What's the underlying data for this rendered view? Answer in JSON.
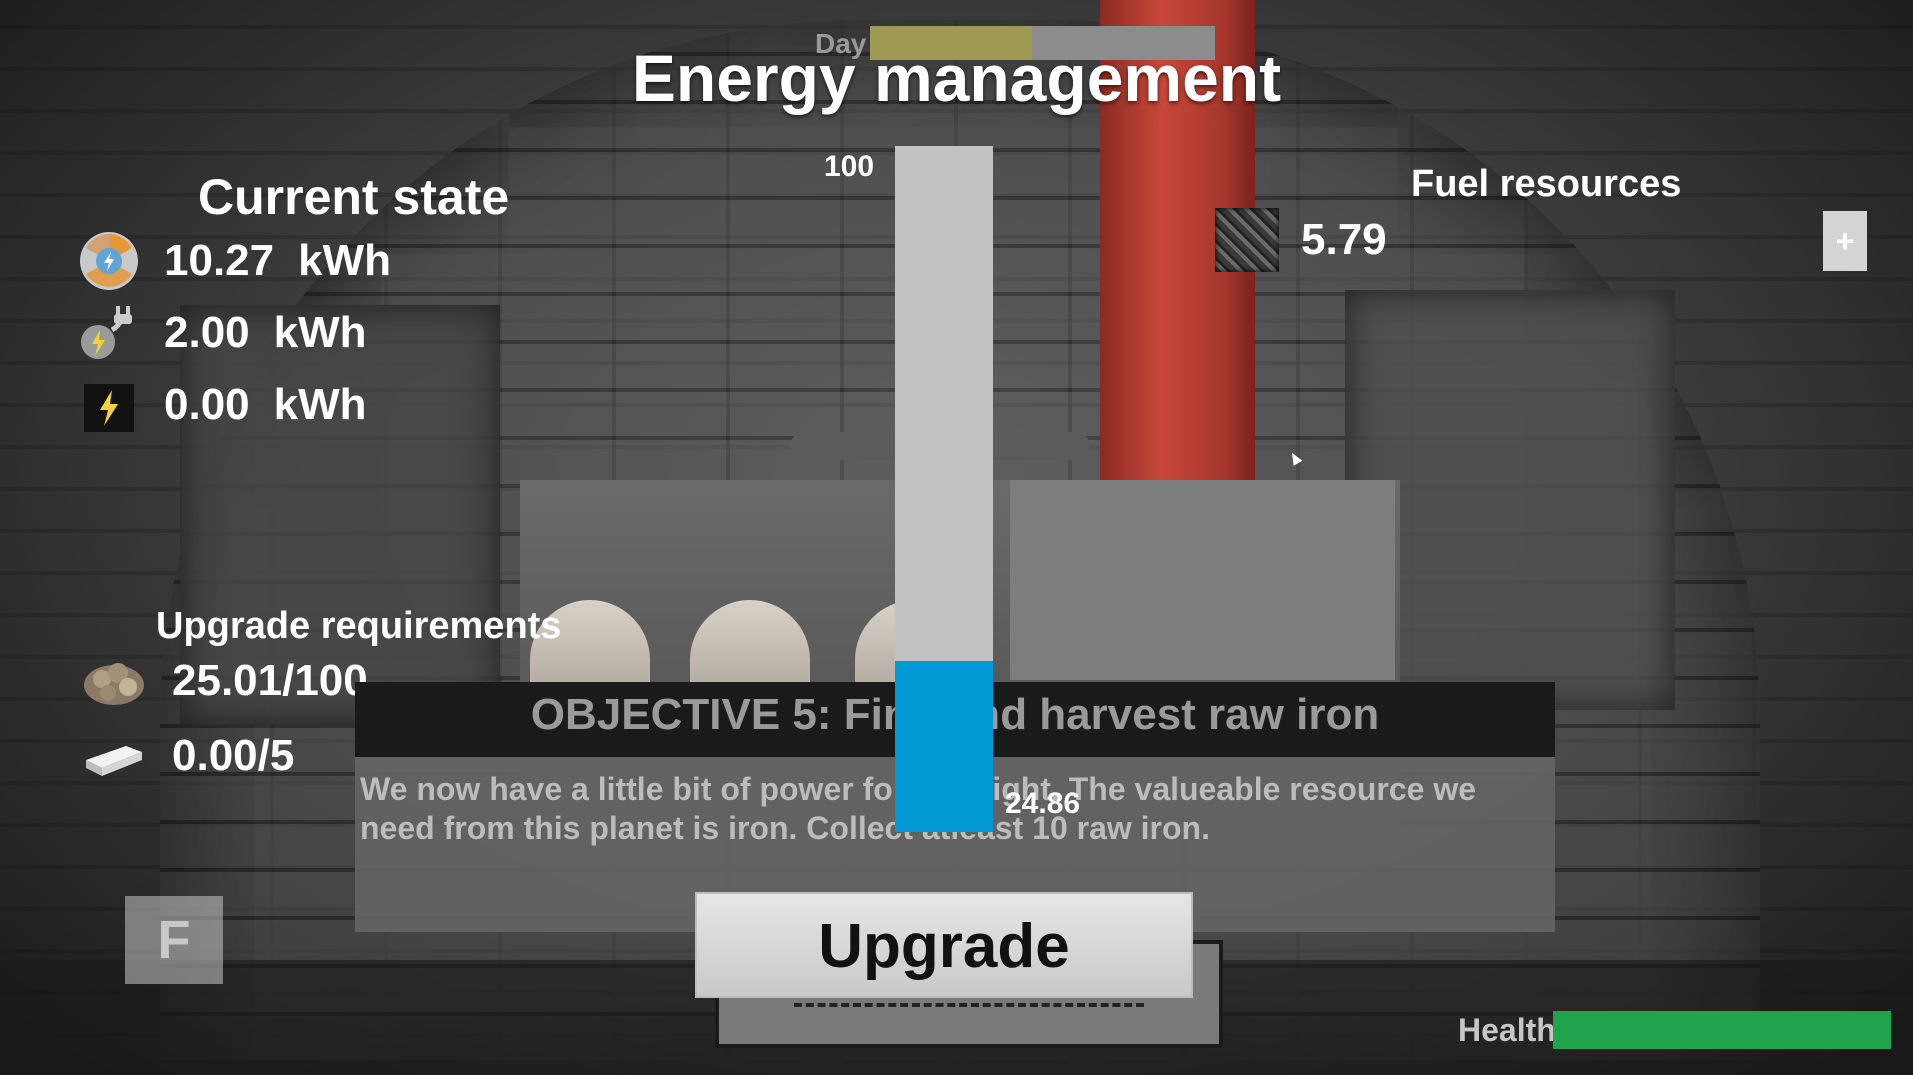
{
  "hud": {
    "day_label": "Day",
    "day_progress": 0.47,
    "title": "Energy management"
  },
  "current_state": {
    "heading": "Current state",
    "rows": [
      {
        "icon": "energy-core-icon",
        "value": "10.27",
        "unit": "kWh"
      },
      {
        "icon": "power-plug-icon",
        "value": "2.00",
        "unit": "kWh"
      },
      {
        "icon": "battery-icon",
        "value": "0.00",
        "unit": "kWh"
      }
    ]
  },
  "upgrade_requirements": {
    "heading": "Upgrade requirements",
    "rows": [
      {
        "icon": "raw-ore-icon",
        "value": "25.01/100"
      },
      {
        "icon": "iron-ingot-icon",
        "value": "0.00/5"
      }
    ]
  },
  "fuel": {
    "heading": "Fuel resources",
    "icon": "coal-icon",
    "value": "5.79",
    "add_label": "+"
  },
  "gauge": {
    "max_label": "100",
    "value_label": "24.86",
    "level": 0.2486,
    "fill_color": "#0298d6"
  },
  "objective": {
    "title": "OBJECTIVE 5: Find and harvest raw iron",
    "text": "We now have a little bit of power for it to fight. The valueable resource we need from this planet is iron. Collect atleast 10 raw iron."
  },
  "upgrade_button": "Upgrade",
  "interact_key": "F",
  "health": {
    "label": "Health",
    "level": 1.0,
    "color": "#1fa34d"
  }
}
